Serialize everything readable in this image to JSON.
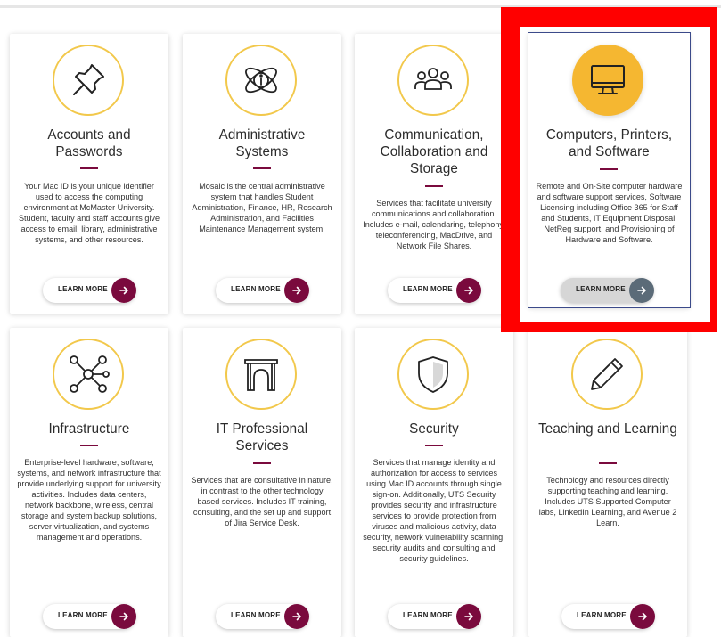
{
  "cards": [
    {
      "title": "Accounts and Passwords",
      "icon": "pushpin-icon",
      "description": "Your Mac ID is your unique identifier used to access the computing environment at McMaster University. Student, faculty and staff accounts give access to email, library, administrative systems, and other resources.",
      "button": "LEARN MORE"
    },
    {
      "title": "Administrative Systems",
      "icon": "atom-info-icon",
      "description": "Mosaic is the central administrative system that handles Student Administration, Finance, HR, Research Administration, and Facilities Maintenance Management system.",
      "button": "LEARN MORE"
    },
    {
      "title": "Communication, Collaboration and Storage",
      "icon": "people-group-icon",
      "description": "Services that facilitate university communications and collaboration. Includes e-mail, calendaring, telephony, teleconferencing, MacDrive, and Network File Shares.",
      "button": "LEARN MORE"
    },
    {
      "title": "Computers, Printers, and Software",
      "icon": "monitor-icon",
      "description": "Remote and On-Site computer hardware and software support services, Software Licensing including Office 365 for Staff and Students, IT Equipment Disposal, NetReg support, and Provisioning of Hardware and Software.",
      "button": "LEARN MORE"
    },
    {
      "title": "Infrastructure",
      "icon": "network-hub-icon",
      "description": "Enterprise-level hardware, software, systems, and network infrastructure that provide underlying support for university activities. Includes data centers, network backbone, wireless, central storage and system backup solutions, server virtualization, and systems management and operations.",
      "button": "LEARN MORE"
    },
    {
      "title": "IT Professional Services",
      "icon": "archway-icon",
      "description": "Services that are consultative in nature, in contrast to the other technology based services. Includes IT training, consulting, and the set up and support of Jira Service Desk.",
      "button": "LEARN MORE"
    },
    {
      "title": "Security",
      "icon": "shield-icon",
      "description": "Services that manage identity and authorization for access to services using Mac ID accounts through single sign-on. Additionally, UTS Security provides security and infrastructure services to provide protection from viruses and malicious activity, data security, network vulnerability scanning, security audits and consulting and security guidelines.",
      "button": "LEARN MORE"
    },
    {
      "title": "Teaching and Learning",
      "icon": "pencil-icon",
      "description": "Technology and resources directly supporting teaching and learning. Includes UTS Supported Computer labs, LinkedIn Learning, and Avenue 2 Learn.",
      "button": "LEARN MORE"
    }
  ],
  "colors": {
    "accent": "#7a0a3d",
    "gold": "#f5b731",
    "highlight": "#ff0000",
    "hover_arrow": "#5b6b78"
  }
}
